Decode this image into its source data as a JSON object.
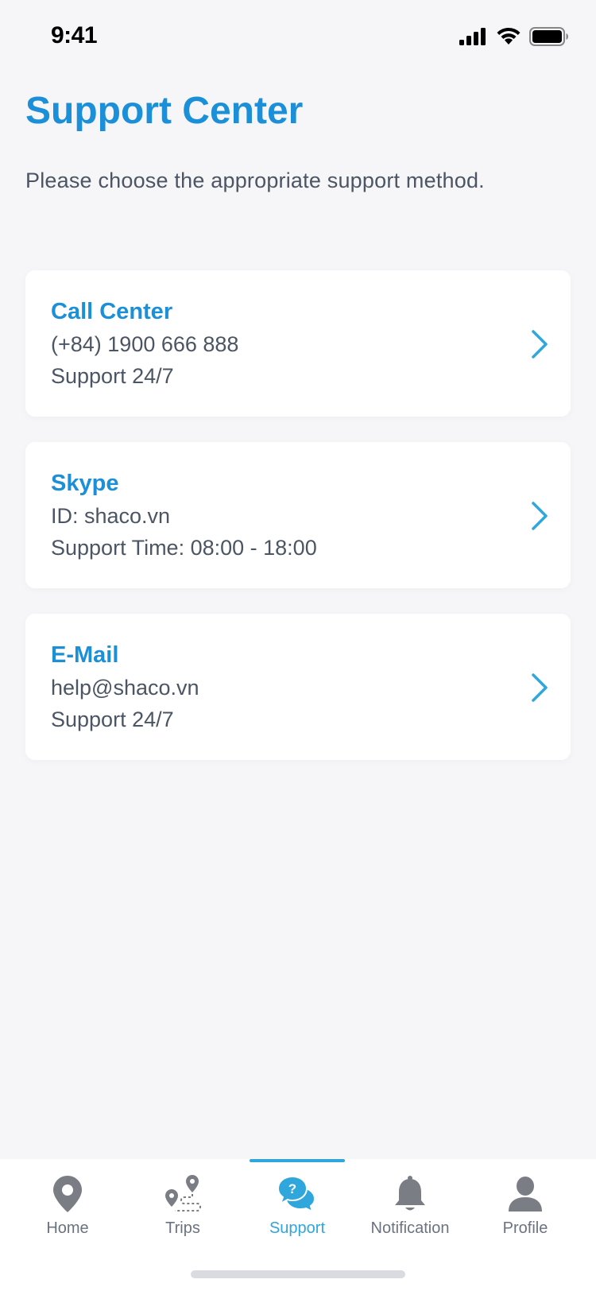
{
  "status_bar": {
    "time": "9:41"
  },
  "header": {
    "title": "Support Center",
    "subtitle": "Please choose the appropriate support method."
  },
  "support_methods": [
    {
      "title": "Call Center",
      "line1": "(+84) 1900 666 888",
      "line2": "Support 24/7"
    },
    {
      "title": "Skype",
      "line1": "ID: shaco.vn",
      "line2": "Support Time: 08:00 - 18:00"
    },
    {
      "title": "E-Mail",
      "line1": "help@shaco.vn",
      "line2": "Support 24/7"
    }
  ],
  "tab_bar": {
    "active": "Support",
    "tabs": [
      {
        "label": "Home",
        "icon": "map-pin-icon"
      },
      {
        "label": "Trips",
        "icon": "route-icon"
      },
      {
        "label": "Support",
        "icon": "support-chat-icon"
      },
      {
        "label": "Notification",
        "icon": "bell-icon"
      },
      {
        "label": "Profile",
        "icon": "user-icon"
      }
    ]
  },
  "colors": {
    "accent": "#1b8fd8",
    "tab_active": "#2fa6dc",
    "text": "#4b5563",
    "icon_inactive": "#6b7280",
    "background": "#f6f6f8"
  }
}
